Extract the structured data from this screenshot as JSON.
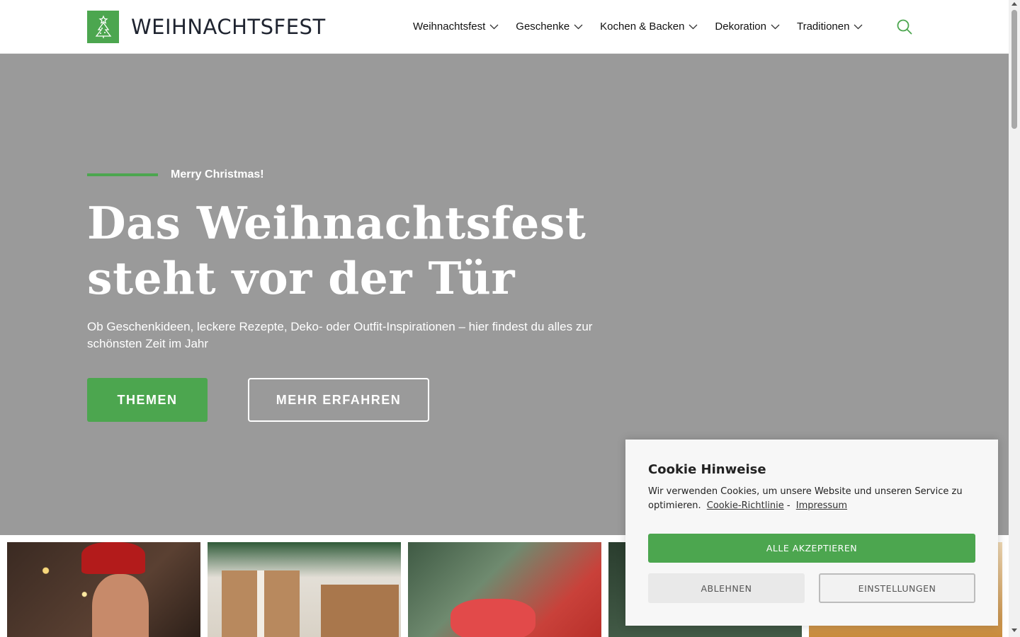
{
  "header": {
    "logo_text": "WEIHNACHTSFEST",
    "nav": [
      {
        "label": "Weihnachtsfest"
      },
      {
        "label": "Geschenke"
      },
      {
        "label": "Kochen & Backen"
      },
      {
        "label": "Dekoration"
      },
      {
        "label": "Traditionen"
      }
    ],
    "icons": {
      "logo": "christmas-tree-icon",
      "dropdown": "chevron-down-icon",
      "search": "search-icon"
    }
  },
  "hero": {
    "eyebrow": "Merry Christmas!",
    "title_line1": "Das Weihnachtsfest",
    "title_line2": "steht vor der Tür",
    "subtitle": "Ob Geschenkideen, leckere Rezepte, Deko- oder Outfit-Inspirationen – hier findest du alles zur schönsten Zeit im Jahr",
    "primary_button": "THEMEN",
    "secondary_button": "MEHR ERFAHREN"
  },
  "cookie": {
    "title": "Cookie Hinweise",
    "text": "Wir verwenden Cookies, um unsere Website und unseren Service zu optimieren.",
    "link_policy": "Cookie-Richtlinie",
    "separator": "-",
    "link_imprint": "Impressum",
    "accept_all": "ALLE AKZEPTIEREN",
    "reject": "ABLEHNEN",
    "settings": "EINSTELLUNGEN"
  },
  "colors": {
    "accent": "#4ca64f",
    "hero_bg": "#9a9a9a",
    "text_dark": "#1f2430"
  }
}
